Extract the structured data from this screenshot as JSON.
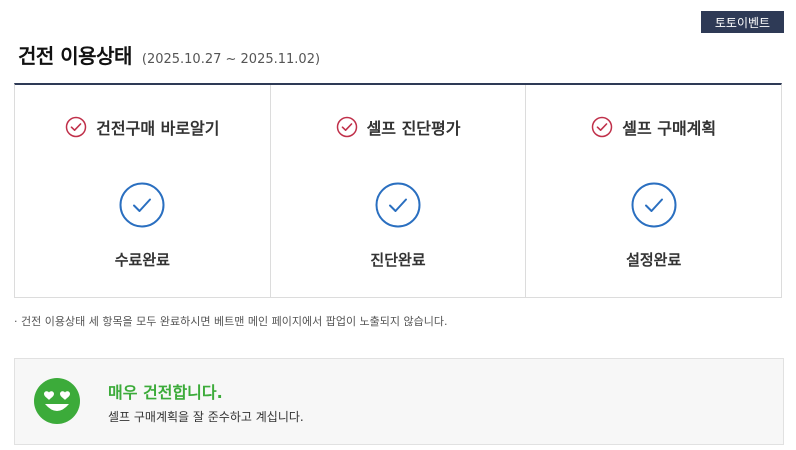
{
  "header": {
    "event_button": "토토이벤트",
    "title": "건전 이용상태",
    "period": "(2025.10.27 ~ 2025.11.02)"
  },
  "columns": [
    {
      "title": "건전구매 바로알기",
      "status": "수료완료"
    },
    {
      "title": "셀프 진단평가",
      "status": "진단완료"
    },
    {
      "title": "셀프 구매계획",
      "status": "설정완료"
    }
  ],
  "note": "· 건전 이용상태 세 항목을 모두 완료하시면 베트맨 메인 페이지에서 팝업이 노출되지 않습니다.",
  "result": {
    "title": "매우 건전합니다.",
    "description": "셀프 구매계획을 잘 준수하고 계십니다."
  },
  "colors": {
    "navy": "#2e3a56",
    "check_red": "#c0304a",
    "check_blue": "#2a6fc0",
    "green": "#3cab3a"
  }
}
